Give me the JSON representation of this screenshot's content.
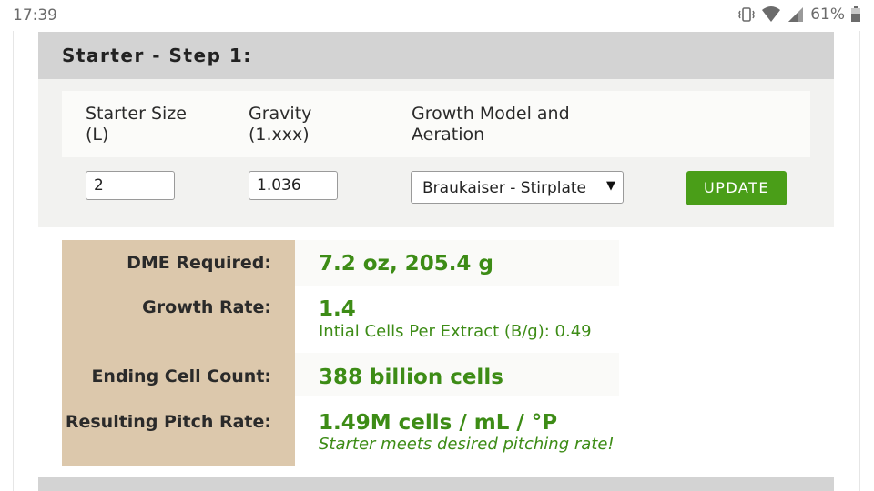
{
  "status_bar": {
    "time": "17:39",
    "battery_percent": "61%",
    "icons": [
      "vibrate-icon",
      "wifi-icon",
      "cell-signal-icon",
      "battery-icon"
    ]
  },
  "step": {
    "title": "Starter - Step 1:"
  },
  "form": {
    "starter_size_label": "Starter Size (L)",
    "gravity_label": "Gravity (1.xxx)",
    "growth_label": "Growth Model and Aeration",
    "starter_size_value": "2",
    "gravity_value": "1.036",
    "growth_selected": "Braukaiser - Stirplate",
    "update_label": "UPDATE"
  },
  "results": {
    "dme_label": "DME Required:",
    "dme_value": "7.2 oz, 205.4 g",
    "growth_rate_label": "Growth Rate:",
    "growth_rate_value": "1.4",
    "growth_rate_sub": "Intial Cells Per Extract (B/g): 0.49",
    "ending_label": "Ending Cell Count:",
    "ending_value": "388 billion cells",
    "pitch_label": "Resulting Pitch Rate:",
    "pitch_value": "1.49M cells / mL / °P",
    "pitch_note": "Starter meets desired pitching rate!"
  },
  "colors": {
    "accent_green": "#4a9e18",
    "value_green": "#3d8c16",
    "label_column": "#dcc8ac",
    "header_gray": "#d3d3d3"
  }
}
